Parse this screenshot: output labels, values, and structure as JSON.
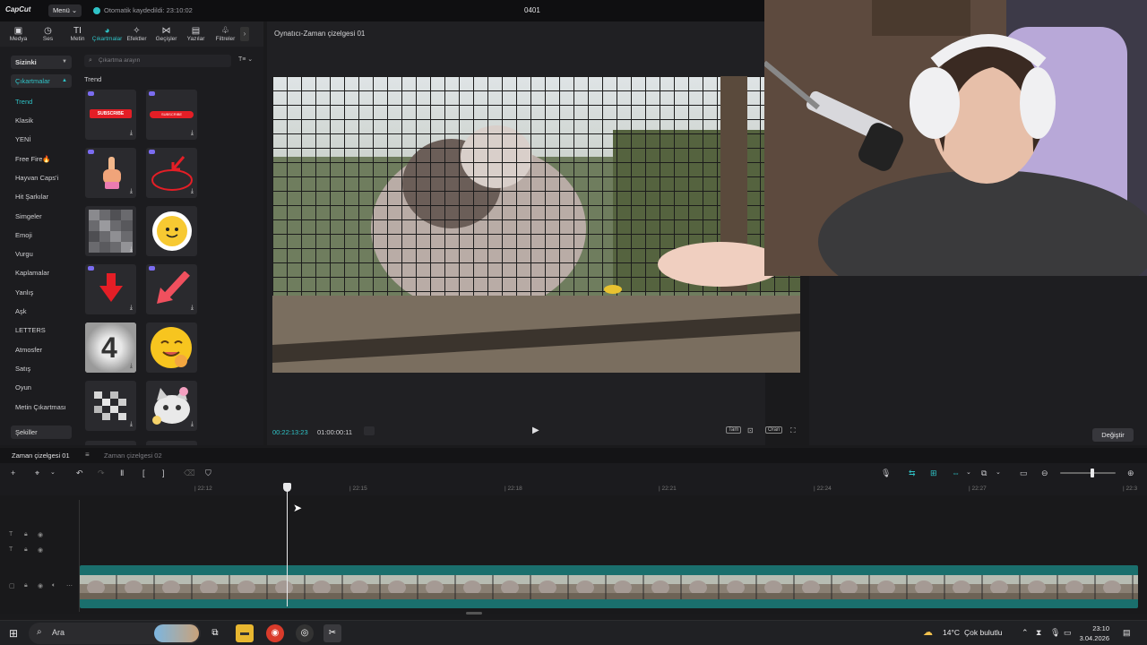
{
  "titlebar": {
    "logo": "CapCut",
    "menu": "Menü ⌄",
    "autosave": "Otomatik kaydedildi: 23:10:02",
    "project": "0401"
  },
  "toolbar": {
    "items": [
      {
        "icon": "▣",
        "label": "Medya"
      },
      {
        "icon": "◷",
        "label": "Ses"
      },
      {
        "icon": "TI",
        "label": "Metin"
      },
      {
        "icon": "◕",
        "label": "Çıkartmalar"
      },
      {
        "icon": "✧",
        "label": "Efektler"
      },
      {
        "icon": "⋈",
        "label": "Geçişler"
      },
      {
        "icon": "▤",
        "label": "Yazılar"
      },
      {
        "icon": "♧",
        "label": "Filtreler"
      }
    ],
    "more": "›"
  },
  "left": {
    "dropdown": "Sizinki",
    "sub": "Çıkartmalar",
    "categories": [
      "Trend",
      "Klasik",
      "YENİ",
      "Free Fire🔥",
      "Hayvan Caps'i",
      "Hit Şarkılar",
      "Simgeler",
      "Emoji",
      "Vurgu",
      "Kaplamalar",
      "Yanlış",
      "Aşk",
      "LETTERS",
      "Atmosfer",
      "Satış",
      "Oyun",
      "Metin Çıkartması"
    ],
    "bottom": "Şekiller"
  },
  "stickers": {
    "search_placeholder": "Çıkartma arayın",
    "filter": "T≡ ⌄",
    "section": "Trend",
    "tiles": [
      "subscribe",
      "subscribe-bell",
      "hand-pointing",
      "red-circle-arrow",
      "pixel-blur",
      "sun-flower",
      "red-arrow-down",
      "red-arrow-diagonal",
      "countdown-4",
      "yummy-emoji",
      "pixel-blur-2",
      "cat-meme"
    ],
    "countdown": "4",
    "subscribe_text": "SUBSCRIBE"
  },
  "player": {
    "title": "Oynatıcı-Zaman çizelgesi 01",
    "time": "00:22:13:23",
    "duration": "01:00:00:11",
    "ratio1": "Tam",
    "ratio2": "Oran"
  },
  "right": {
    "change_btn": "Değiştir"
  },
  "timeline": {
    "tab1": "Zaman çizelgesi 01",
    "tab2": "Zaman çizelgesi 02",
    "ticks": [
      "| 22:12",
      "| 22:15",
      "| 22:18",
      "| 22:21",
      "| 22:24",
      "| 22:27",
      "| 22:3"
    ]
  },
  "taskbar": {
    "search": "Ara",
    "weather_temp": "14°C",
    "weather_desc": "Çok bulutlu",
    "time": "23:10",
    "date": "3.04.2026"
  }
}
